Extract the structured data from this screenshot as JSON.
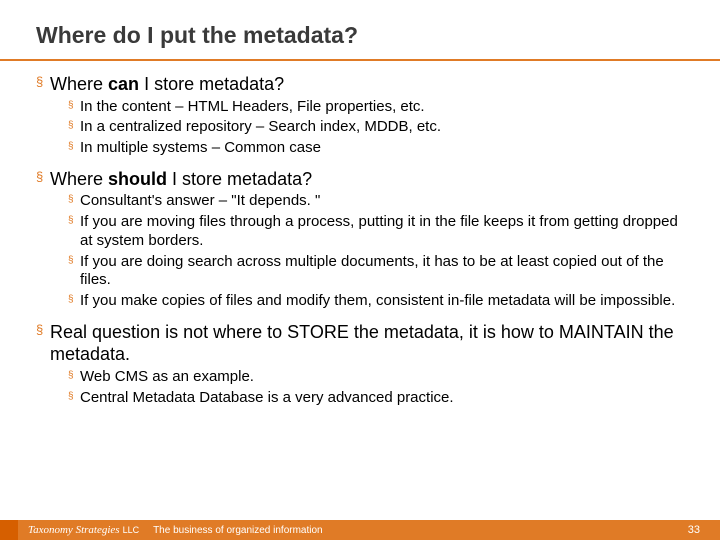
{
  "title": "Where do I put the metadata?",
  "b1": {
    "lead": "Where ",
    "bold": "can",
    "tail": " I store metadata?",
    "sub": [
      "In the content – HTML Headers, File properties, etc.",
      "In a centralized repository – Search index, MDDB, etc.",
      "In multiple systems – Common case"
    ]
  },
  "b2": {
    "lead": "Where ",
    "bold": "should",
    "tail": " I store metadata?",
    "sub": [
      "Consultant's answer – \"It depends. \"",
      "If you are moving files through a process, putting it in the file keeps it from getting dropped at system borders.",
      "If you are doing search across multiple documents, it has to be at least copied out of the files.",
      "If you make copies of files and modify them, consistent in-file metadata will be impossible."
    ]
  },
  "b3": {
    "text": "Real question is not where to STORE the metadata, it is how to MAINTAIN the metadata.",
    "sub": [
      "Web CMS as an example.",
      "Central Metadata Database is a very advanced practice."
    ]
  },
  "footer": {
    "company": "Taxonomy Strategies",
    "llc": "LLC",
    "tagline": "The business of organized information",
    "page": "33"
  }
}
